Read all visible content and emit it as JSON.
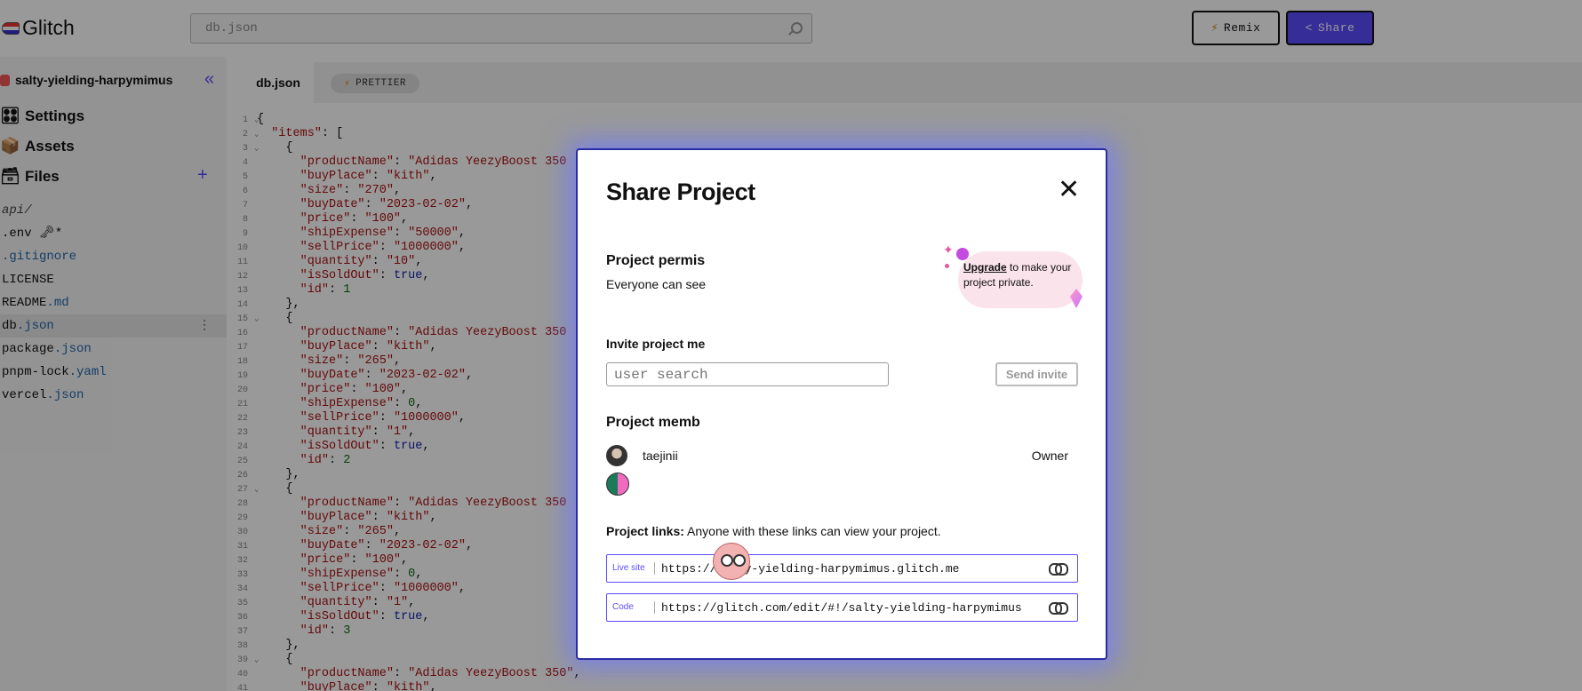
{
  "header": {
    "logo_text": "Glitch",
    "search_placeholder": "db.json",
    "remix_label": "Remix",
    "share_label": "Share",
    "remix_icon": "⚡",
    "share_icon": "<"
  },
  "sidebar": {
    "project_name": "salty-yielding-harpymimus",
    "collapse_icon": "«",
    "links": [
      {
        "label": "Settings",
        "icon": "🎛"
      },
      {
        "label": "Assets",
        "icon": "📦"
      },
      {
        "label": "Files",
        "icon": "🗃"
      }
    ],
    "add_icon": "+",
    "files": [
      {
        "name": "api/",
        "ext": ""
      },
      {
        "name": ".env 🗝*",
        "ext": ""
      },
      {
        "name": ".gitignore",
        "ext": ""
      },
      {
        "name": "LICENSE",
        "ext": ""
      },
      {
        "name": "README",
        "ext": ".md"
      },
      {
        "name": "db",
        "ext": ".json"
      },
      {
        "name": "package",
        "ext": ".json"
      },
      {
        "name": "pnpm-lock",
        "ext": ".yaml"
      },
      {
        "name": "vercel",
        "ext": ".json"
      }
    ]
  },
  "tabs": {
    "active": "db.json",
    "prettier_label": "PRETTIER",
    "prettier_icon": "⚡"
  },
  "modal": {
    "title": "Share Project",
    "close_icon": "✕",
    "permissions_title": "Project permis",
    "permissions_text": "Everyone can see",
    "upgrade_link": "Upgrade",
    "upgrade_text": " to make your project private.",
    "invite_title": "Invite project me",
    "invite_placeholder": "user search",
    "send_invite_label": "Send invite",
    "members_title": "Project memb",
    "members": [
      {
        "name": "taejinii",
        "role": "Owner"
      }
    ],
    "links_title_bold": "Project links:",
    "links_title_text": " Anyone with these links can view your project.",
    "live_label": "Live site",
    "live_url": "https://salty-yielding-harpymimus.glitch.me",
    "code_label": "Code",
    "code_url": "https://glitch.com/edit/#!/salty-yielding-harpymimus"
  }
}
